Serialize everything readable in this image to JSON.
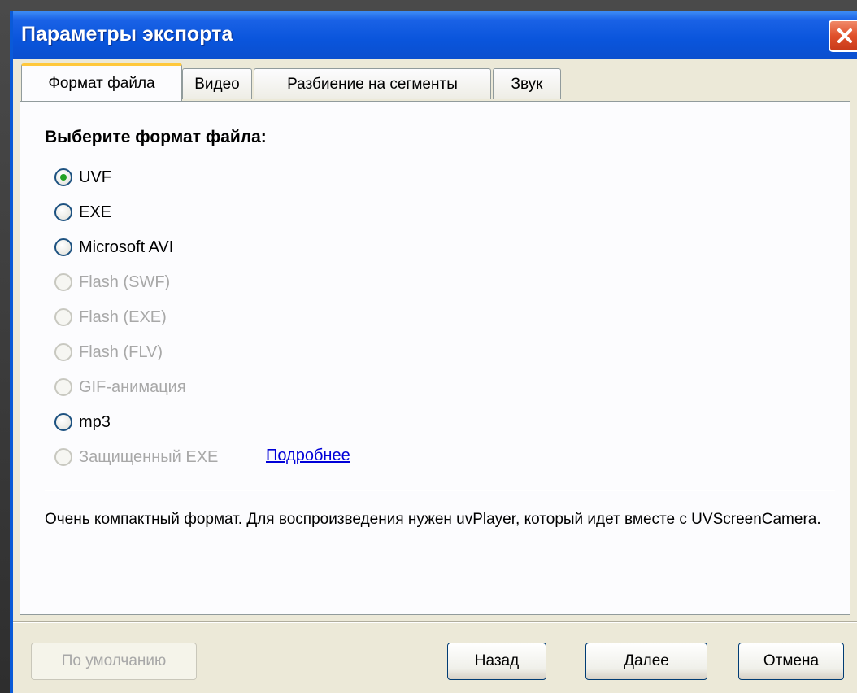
{
  "window": {
    "title": "Параметры экспорта"
  },
  "tabs": [
    {
      "label": "Формат файла",
      "active": true
    },
    {
      "label": "Видео",
      "active": false
    },
    {
      "label": "Разбиение на сегменты",
      "active": false
    },
    {
      "label": "Звук",
      "active": false
    }
  ],
  "panel": {
    "heading": "Выберите формат файла:",
    "options": [
      {
        "label": "UVF",
        "selected": true,
        "enabled": true
      },
      {
        "label": "EXE",
        "selected": false,
        "enabled": true
      },
      {
        "label": "Microsoft AVI",
        "selected": false,
        "enabled": true
      },
      {
        "label": "Flash (SWF)",
        "selected": false,
        "enabled": false
      },
      {
        "label": "Flash (EXE)",
        "selected": false,
        "enabled": false
      },
      {
        "label": "Flash (FLV)",
        "selected": false,
        "enabled": false
      },
      {
        "label": "GIF-анимация",
        "selected": false,
        "enabled": false
      },
      {
        "label": "mp3",
        "selected": false,
        "enabled": true
      },
      {
        "label": "Защищенный EXE",
        "selected": false,
        "enabled": false
      }
    ],
    "more_link": "Подробнее",
    "description": "Очень компактный формат. Для воспроизведения нужен uvPlayer, который идет вместе с UVScreenCamera."
  },
  "buttons": {
    "defaults": "По умолчанию",
    "back": "Назад",
    "next": "Далее",
    "cancel": "Отмена"
  },
  "colors": {
    "titlebar": "#0a55dc",
    "selected_dot": "#21a121",
    "link": "#0000d8",
    "disabled_text": "#a8a8a8"
  }
}
